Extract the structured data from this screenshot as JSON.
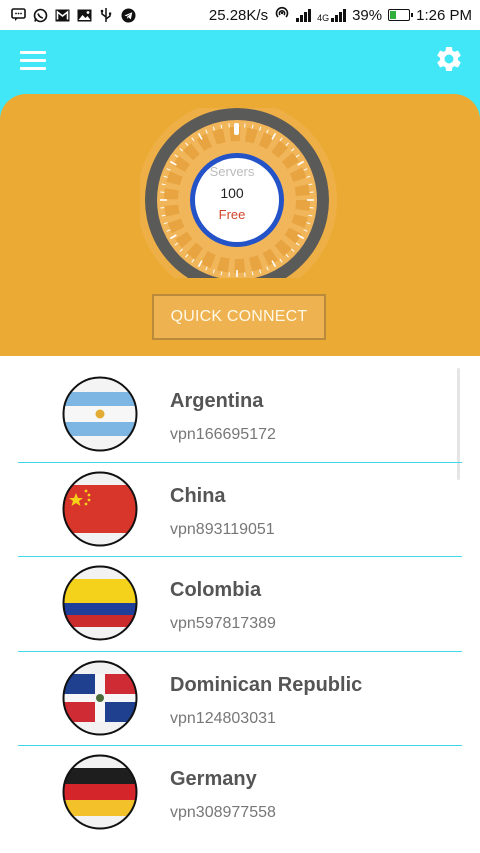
{
  "status_bar": {
    "speed": "25.28K/s",
    "network": "4G",
    "battery": "39%",
    "time": "1:26 PM",
    "battery_level": 0.39
  },
  "app_bar": {
    "menu_icon": "hamburger-menu-icon",
    "settings_icon": "gear-icon"
  },
  "hero": {
    "dial_label": "Servers",
    "server_count": "100",
    "tier": "Free",
    "quick_connect": "QUICK CONNECT"
  },
  "servers": [
    {
      "country": "Argentina",
      "id": "vpn166695172",
      "flag": "argentina-flag"
    },
    {
      "country": "China",
      "id": "vpn893119051",
      "flag": "china-flag"
    },
    {
      "country": "Colombia",
      "id": "vpn597817389",
      "flag": "colombia-flag"
    },
    {
      "country": "Dominican Republic",
      "id": "vpn124803031",
      "flag": "dominican-republic-flag"
    },
    {
      "country": "Germany",
      "id": "vpn308977558",
      "flag": "germany-flag"
    }
  ],
  "colors": {
    "accent": "#41e7f6",
    "hero": "#ebaa33",
    "divider": "#41d6ea"
  }
}
